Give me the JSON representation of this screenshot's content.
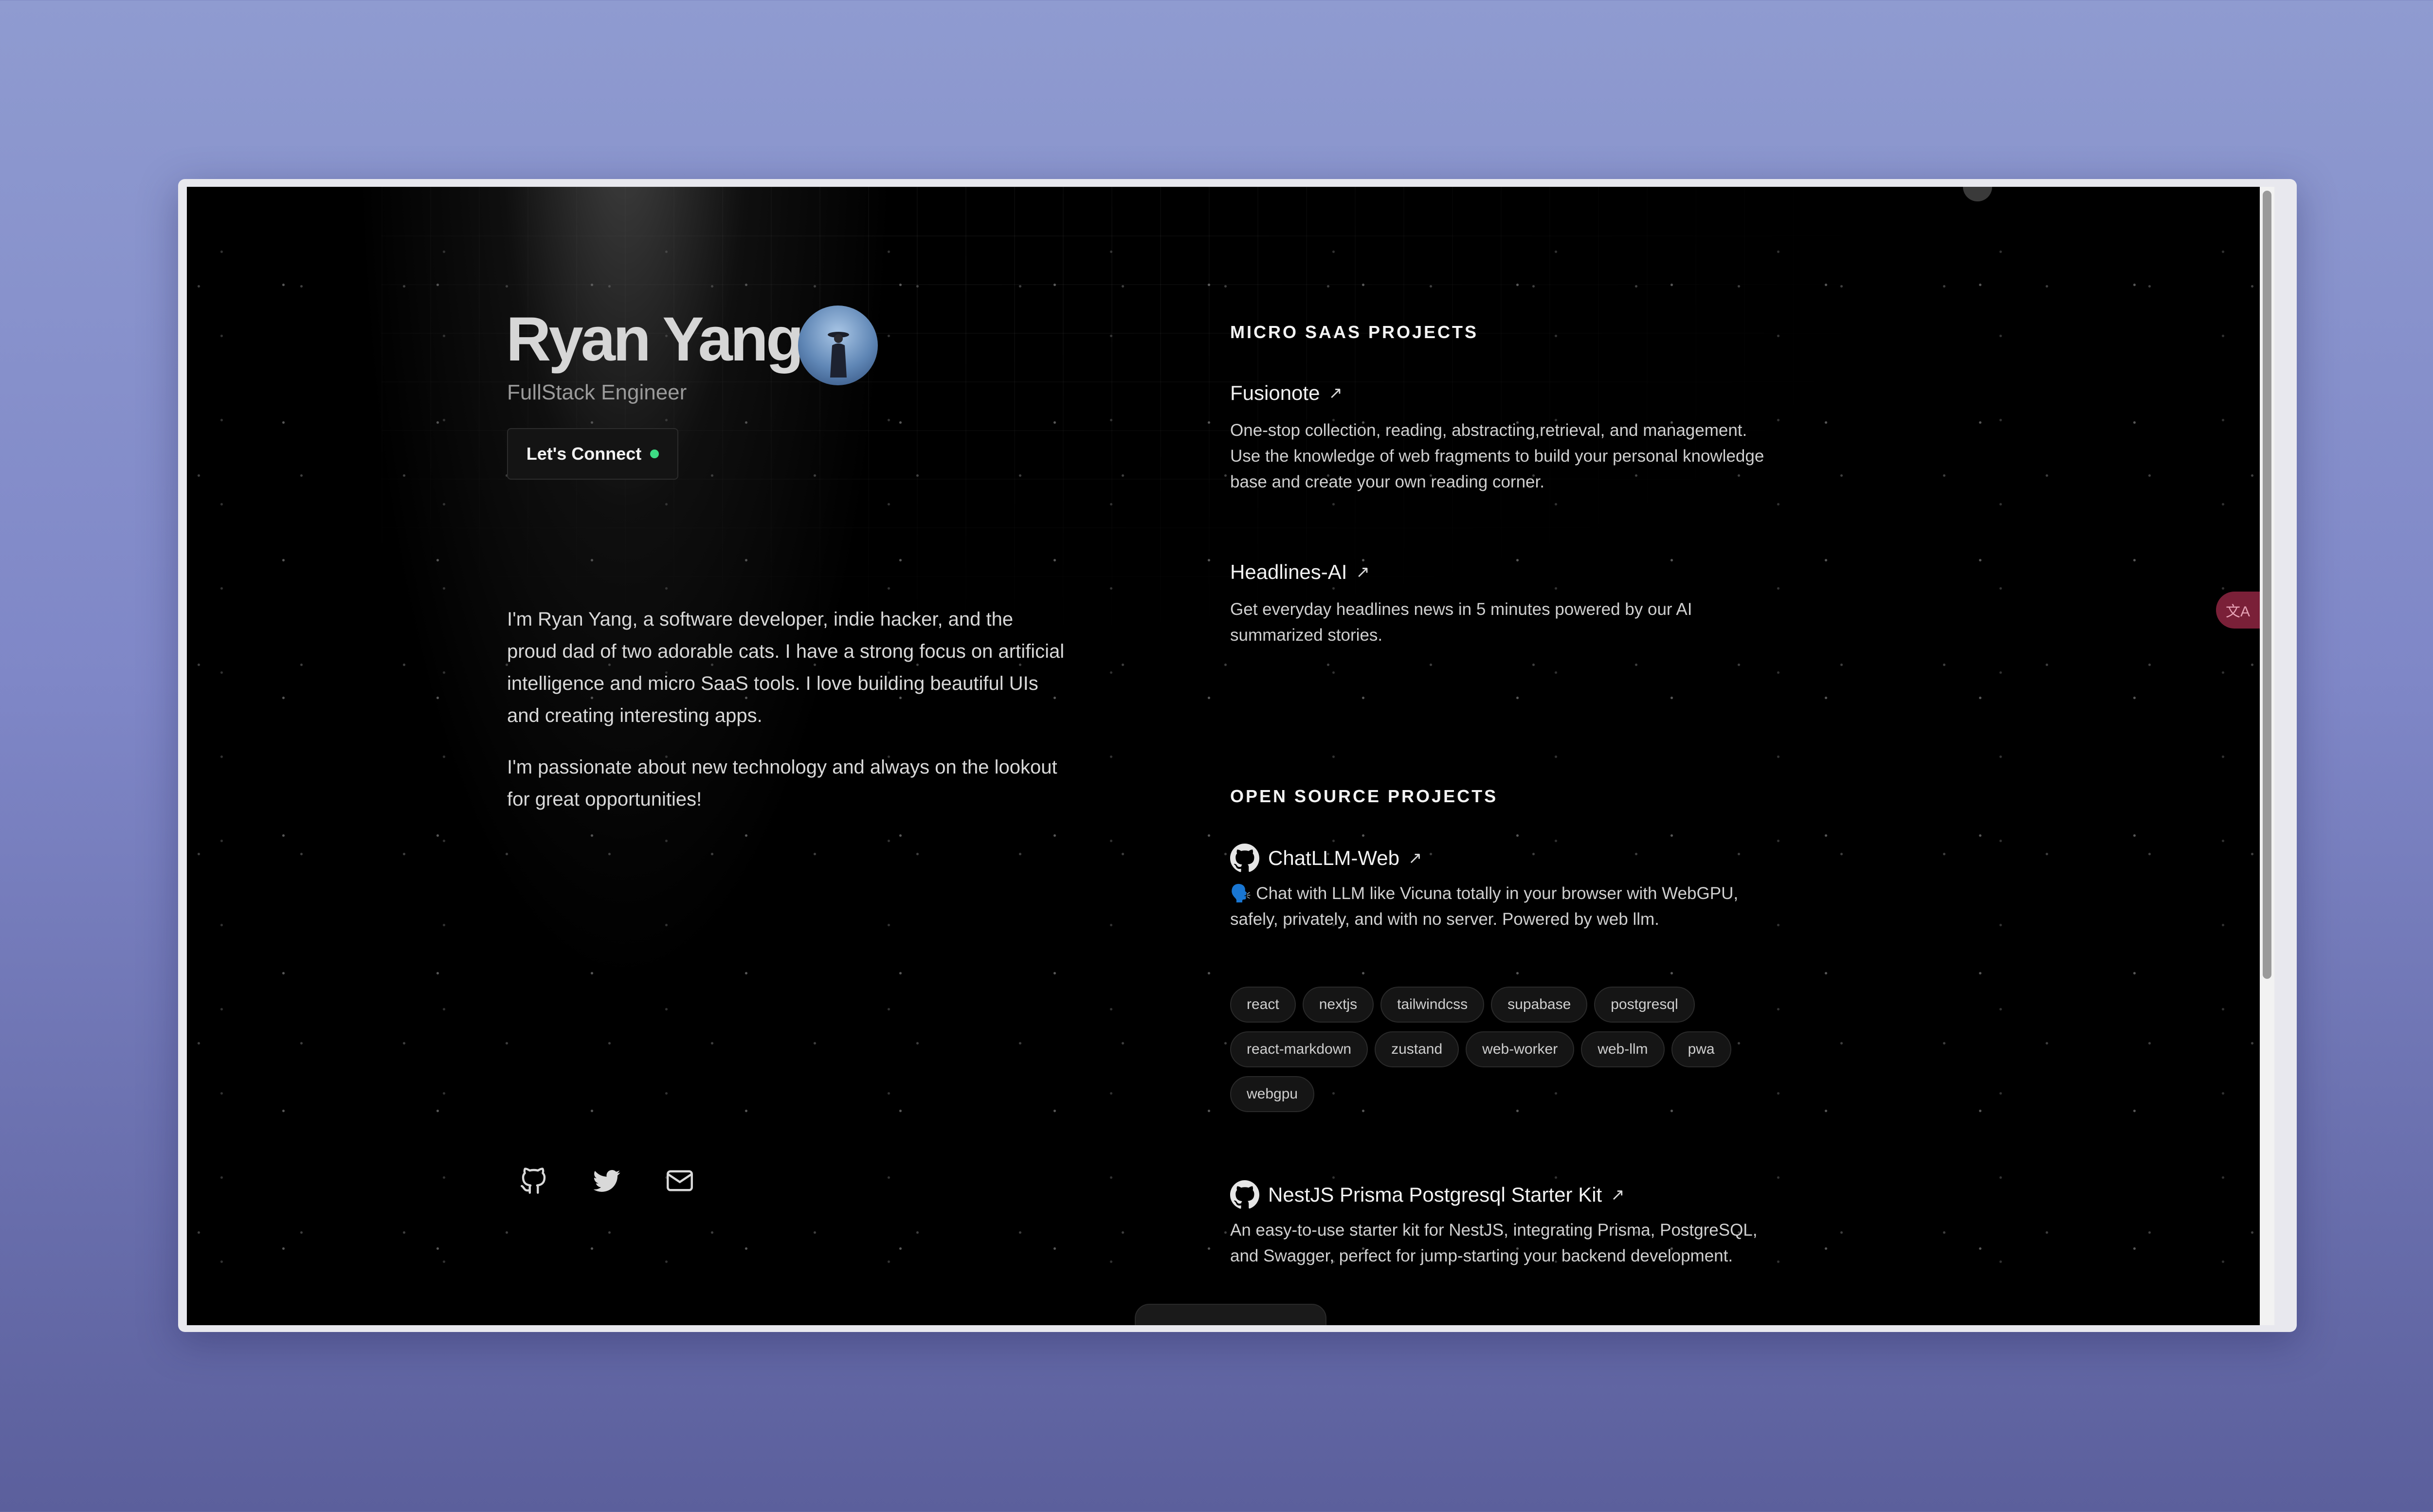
{
  "profile": {
    "name": "Ryan Yang",
    "role": "FullStack Engineer",
    "connect_label": "Let's Connect",
    "about": [
      "I'm Ryan Yang, a software developer, indie hacker, and the proud dad of two adorable cats. I have a strong focus on artificial intelligence and micro SaaS tools. I love building beautiful UIs and creating interesting apps.",
      "I'm passionate about new technology and always on the lookout for great opportunities!"
    ],
    "socials": [
      "github-icon",
      "twitter-icon",
      "mail-icon"
    ]
  },
  "micro_saas": {
    "title": "MICRO SAAS PROJECTS",
    "projects": [
      {
        "name": "Fusionote",
        "arrow": "↗",
        "description": "One-stop collection, reading, abstracting,retrieval, and management. Use the knowledge of web fragments to build your personal knowledge base and create your own reading corner."
      },
      {
        "name": "Headlines-AI",
        "arrow": "↗",
        "description": "Get everyday headlines news in 5 minutes powered by our AI summarized stories."
      }
    ]
  },
  "open_source": {
    "title": "OPEN SOURCE PROJECTS",
    "projects": [
      {
        "name": "ChatLLM-Web",
        "arrow": "↗",
        "description": "🗣️ Chat with LLM like Vicuna totally in your browser with WebGPU, safely, privately, and with no server. Powered by web llm.",
        "tags": [
          "react",
          "nextjs",
          "tailwindcss",
          "supabase",
          "postgresql",
          "react-markdown",
          "zustand",
          "web-worker",
          "web-llm",
          "pwa",
          "webgpu"
        ]
      },
      {
        "name": "NestJS Prisma Postgresql Starter Kit",
        "arrow": "↗",
        "description": "An easy-to-use starter kit for NestJS, integrating Prisma, PostgreSQL, and Swagger, perfect for jump-starting your backend development."
      }
    ]
  },
  "ui": {
    "translate_icon": "translate-icon",
    "translate_glyph": "文A",
    "accent_green": "#3ddc84"
  }
}
